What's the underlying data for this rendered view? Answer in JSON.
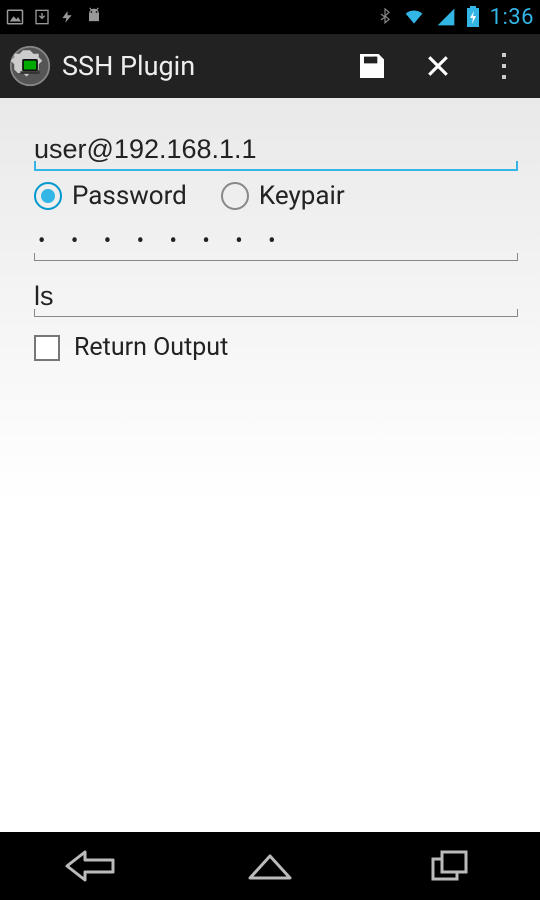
{
  "statusbar": {
    "time": "1:36"
  },
  "actionbar": {
    "title": "SSH Plugin"
  },
  "form": {
    "connection_value": "user@192.168.1.1",
    "auth": {
      "password_label": "Password",
      "keypair_label": "Keypair",
      "selected": "password"
    },
    "password_mask": "• • • • • • • •",
    "command_value": "ls",
    "return_output_label": "Return Output",
    "return_output_checked": false
  }
}
